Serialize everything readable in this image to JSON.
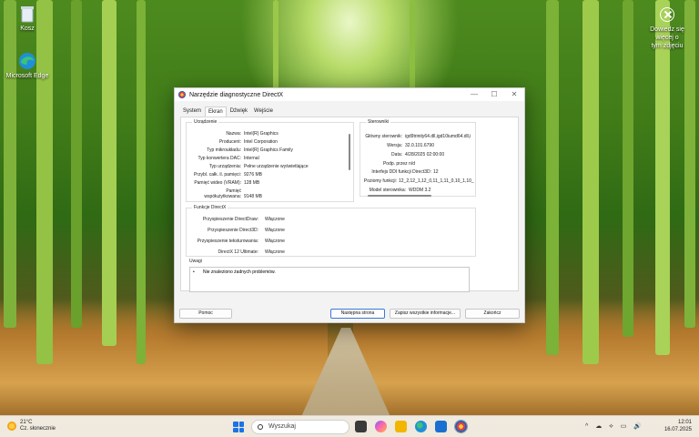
{
  "desktop": {
    "icons": [
      {
        "label": "Kosz"
      },
      {
        "label": "Microsoft Edge"
      }
    ],
    "activation": {
      "line1": "Dowiedz się więcej o",
      "line2": "tym zdjęciu"
    }
  },
  "window": {
    "title": "Narzędzie diagnostyczne DirectX",
    "controls": {
      "minimize": "—",
      "maximize": "☐",
      "close": "✕"
    },
    "tabs": [
      "System",
      "Ekran",
      "Dźwięk",
      "Wejście"
    ],
    "device": {
      "title": "Urządzenie",
      "rows": [
        {
          "label": "Nazwa:",
          "value": "Intel(R) Graphics"
        },
        {
          "label": "Producent:",
          "value": "Intel Corporation"
        },
        {
          "label": "Typ mikroukładu:",
          "value": "Intel(R) Graphics Family"
        },
        {
          "label": "Typ konwertera DAC:",
          "value": "Internal"
        },
        {
          "label": "Typ urządzenia:",
          "value": "Pełne urządzenie wyświetlające"
        },
        {
          "label": "Przybl. całk. il. pamięci:",
          "value": "9276 MB"
        },
        {
          "label": "Pamięć wideo (VRAM):",
          "value": "128 MB"
        },
        {
          "label": "Pamięć",
          "value": ""
        },
        {
          "label": "współużytkowana:",
          "value": "9148 MB"
        }
      ]
    },
    "drivers": {
      "title": "Sterowniki",
      "rows": [
        {
          "label": "Główny sterownik:",
          "value": "igd9trinity64.dll,igd10iumd64.dll,i"
        },
        {
          "label": "Wersja:",
          "value": "32.0.101.6790"
        },
        {
          "label": "Data:",
          "value": "4/28/2025 02:00:00"
        },
        {
          "label": "Podp. przez n/d",
          "value": ""
        },
        {
          "label": "Interfejs DDI funkcji Direct3D:",
          "value": "12"
        },
        {
          "label": "Poziomy funkcji:",
          "value": "12_2,12_1,12_0,11_1,11_0,10_1,10_"
        },
        {
          "label": "Model sterownika:",
          "value": "WDDM 3.2"
        }
      ]
    },
    "directx": {
      "title": "Funkcje DirectX",
      "rows": [
        {
          "label": "Przyspieszenie DirectDraw:",
          "value": "Włączone"
        },
        {
          "label": "Przyspieszenie Direct3D:",
          "value": "Włączone"
        },
        {
          "label": "Przyspieszenie teksturowania:",
          "value": "Włączone"
        },
        {
          "label": "DirectX 12 Ultimate:",
          "value": "Włączone"
        }
      ]
    },
    "notes": {
      "title": "Uwagi",
      "bullet": "•",
      "text": "Nie znaleziono żadnych problemów."
    },
    "buttons": {
      "help": "Pomoc",
      "next": "Następna strona",
      "save": "Zapisz wszystkie informacje...",
      "exit": "Zakończ"
    }
  },
  "taskbar": {
    "weather_temp": "21°C",
    "weather_desc": "Cz. słonecznie",
    "search_placeholder": "Wyszukaj",
    "tray_icons": "^ ☁ ⟡ ▭ 🔊",
    "time": "12:01",
    "date": "16.07.2025"
  },
  "colors": {
    "accent": "#1a73e8",
    "window_bg": "#f3f3f3"
  }
}
